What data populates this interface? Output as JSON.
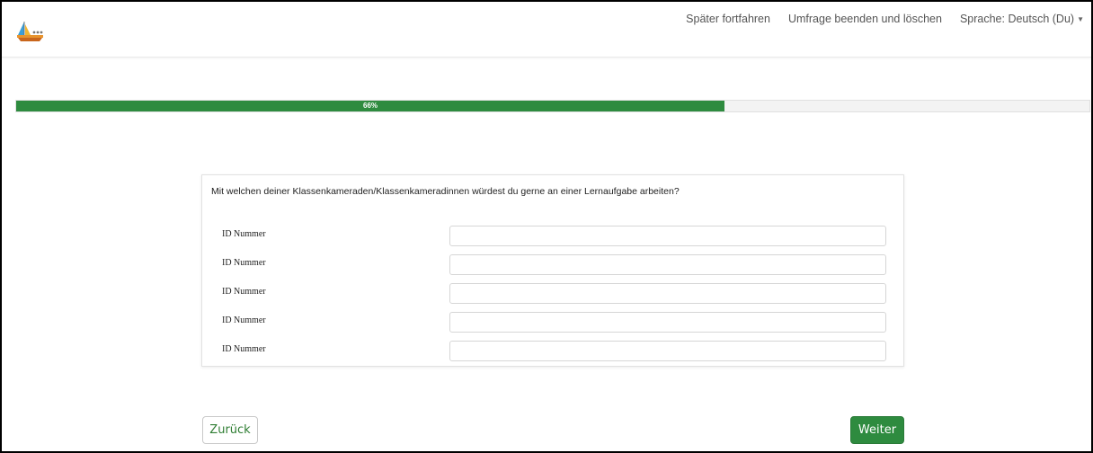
{
  "header": {
    "logo_icon": "sailboat-icon",
    "links": [
      {
        "label": "Später fortfahren"
      },
      {
        "label": "Umfrage beenden und löschen"
      },
      {
        "label": "Sprache: Deutsch (Du)"
      }
    ]
  },
  "progress": {
    "percent": 66,
    "label": "66%",
    "color": "#2e8b3f"
  },
  "question": {
    "text": "Mit welchen deiner Klassenkameraden/Klassenkameradinnen würdest du gerne an einer Lernaufgabe arbeiten?",
    "rows": [
      {
        "label": "ID Nummer",
        "value": ""
      },
      {
        "label": "ID Nummer",
        "value": ""
      },
      {
        "label": "ID Nummer",
        "value": ""
      },
      {
        "label": "ID Nummer",
        "value": ""
      },
      {
        "label": "ID Nummer",
        "value": ""
      }
    ]
  },
  "nav": {
    "back_label": "Zurück",
    "next_label": "Weiter"
  },
  "colors": {
    "accent": "#2e8b3f"
  }
}
